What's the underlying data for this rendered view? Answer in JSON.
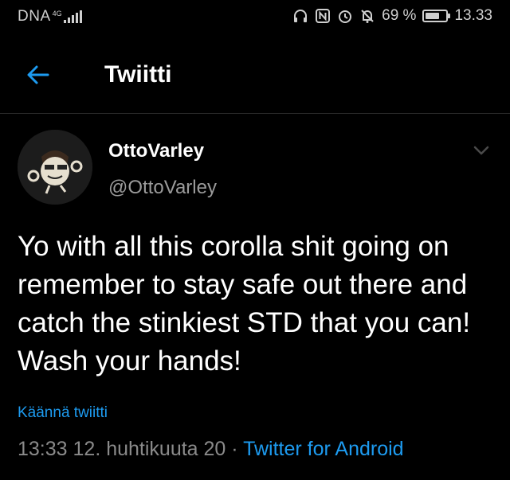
{
  "status_bar": {
    "carrier": "DNA",
    "network": "4G",
    "battery_percent": "69 %",
    "battery_level": 0.69,
    "time": "13.33"
  },
  "header": {
    "title": "Twiitti"
  },
  "tweet": {
    "author_name": "OttoVarley",
    "author_handle": "@OttoVarley",
    "text": "Yo with all this corolla shit going on remember to stay safe out there and catch the stinkiest STD that you can! Wash your hands!",
    "translate_label": "Käännä twiitti",
    "timestamp": "13:33 12. huhtikuuta 20",
    "separator": " · ",
    "source": "Twitter for Android"
  },
  "colors": {
    "background": "#000000",
    "link": "#1d9bf0",
    "secondary_text": "#8a8a8a"
  }
}
